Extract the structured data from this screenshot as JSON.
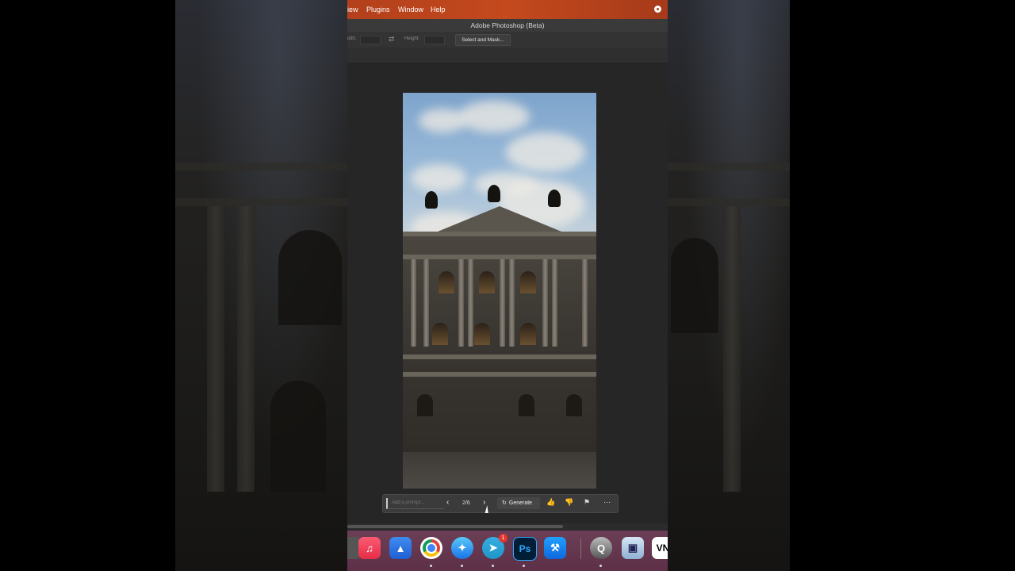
{
  "menubar": {
    "items": [
      "iew",
      "Plugins",
      "Window",
      "Help"
    ]
  },
  "window": {
    "title": "Adobe Photoshop (Beta)"
  },
  "options": {
    "width_label": "idth:",
    "height_label": "Height:",
    "select_mask_label": "Select and Mask..."
  },
  "contextual_task_bar": {
    "prompt_placeholder": "Add a prompt...",
    "variation_counter": "2/6",
    "generate_label": "Generate",
    "more_icon": "⋯"
  },
  "dock": {
    "telegram_badge": "1",
    "apps": [
      "Music",
      "Arc",
      "Chrome",
      "Safari",
      "Telegram",
      "Photoshop",
      "Xcode",
      "QuickTime",
      "Preview",
      "VN"
    ]
  },
  "colors": {
    "menubar": "#c4491d",
    "panel": "#262626",
    "dock": "#5e3048"
  }
}
